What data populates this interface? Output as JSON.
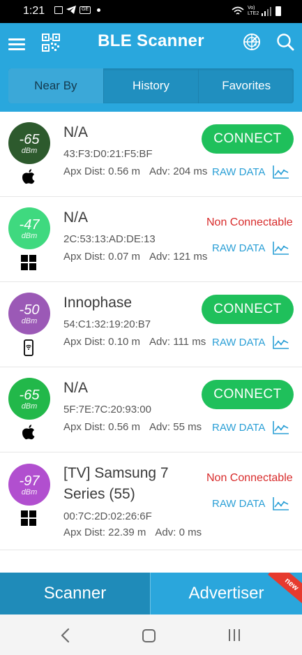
{
  "status_bar": {
    "time": "1:21",
    "network_label": "Vo) LTE2"
  },
  "app_bar": {
    "title": "BLE Scanner",
    "icons": [
      "menu-icon",
      "qr-code-icon",
      "radar-icon",
      "search-icon"
    ]
  },
  "tabs": [
    {
      "label": "Near By",
      "active": true
    },
    {
      "label": "History",
      "active": false
    },
    {
      "label": "Favorites",
      "active": false
    }
  ],
  "devices": [
    {
      "rssi": "-65",
      "unit": "dBm",
      "color": "#2d5a2d",
      "type_icon": "apple-icon",
      "name": "N/A",
      "mac": "43:F3:D0:21:F5:BF",
      "dist": "Apx Dist: 0.56 m",
      "adv": "Adv: 204 ms",
      "connectable": true,
      "action_label": "CONNECT",
      "raw_label": "RAW DATA"
    },
    {
      "rssi": "-47",
      "unit": "dBm",
      "color": "#3fd97f",
      "type_icon": "windows-icon",
      "name": "N/A",
      "mac": "2C:53:13:AD:DE:13",
      "dist": "Apx Dist: 0.07 m",
      "adv": "Adv: 121 ms",
      "connectable": false,
      "action_label": "Non Connectable",
      "raw_label": "RAW DATA"
    },
    {
      "rssi": "-50",
      "unit": "dBm",
      "color": "#9b59b6",
      "type_icon": "phone-wifi-icon",
      "name": "Innophase",
      "mac": "54:C1:32:19:20:B7",
      "dist": "Apx Dist: 0.10 m",
      "adv": "Adv: 111 ms",
      "connectable": true,
      "action_label": "CONNECT",
      "raw_label": "RAW DATA"
    },
    {
      "rssi": "-65",
      "unit": "dBm",
      "color": "#22b84a",
      "type_icon": "apple-icon",
      "name": "N/A",
      "mac": "5F:7E:7C:20:93:00",
      "dist": "Apx Dist: 0.56 m",
      "adv": "Adv: 55 ms",
      "connectable": true,
      "action_label": "CONNECT",
      "raw_label": "RAW DATA"
    },
    {
      "rssi": "-97",
      "unit": "dBm",
      "color": "#b14fcf",
      "type_icon": "windows-icon",
      "name_line1": "[TV] Samsung 7",
      "name_line2": "Series (55)",
      "mac": "00:7C:2D:02:26:6F",
      "dist": "Apx Dist: 22.39 m",
      "adv": "Adv: 0 ms",
      "connectable": false,
      "action_label": "Non Connectable",
      "raw_label": "RAW DATA"
    }
  ],
  "bottom_tabs": {
    "scanner": "Scanner",
    "advertiser": "Advertiser",
    "new_badge": "new"
  },
  "colors": {
    "app_bar": "#29a7dd",
    "connect_green": "#1fc05b",
    "non_connectable_red": "#d82b2b",
    "raw_data_blue": "#2a9fd6"
  }
}
